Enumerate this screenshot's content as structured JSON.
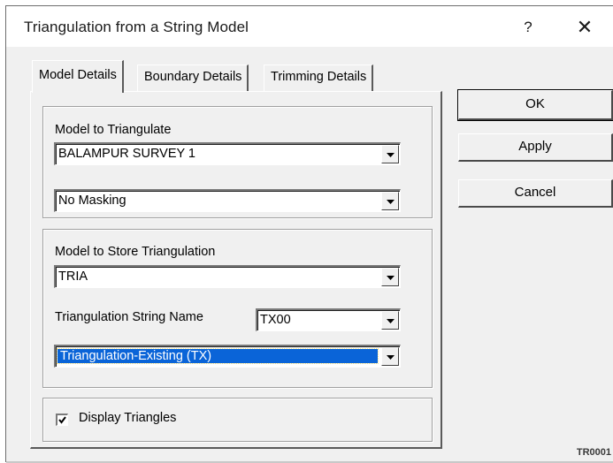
{
  "window": {
    "title": "Triangulation from a String Model",
    "help_label": "?",
    "close_label": "✕"
  },
  "tabs": [
    {
      "label": "Model Details",
      "active": true
    },
    {
      "label": "Boundary Details",
      "active": false
    },
    {
      "label": "Trimming Details",
      "active": false
    }
  ],
  "model_group": {
    "label": "Model to Triangulate",
    "model_value": "BALAMPUR SURVEY 1",
    "masking_value": "No Masking"
  },
  "store_group": {
    "label": "Model to Store Triangulation",
    "store_value": "TRIA",
    "string_name_label": "Triangulation String Name",
    "string_name_value": "TX00",
    "type_value": "Triangulation-Existing (TX)"
  },
  "display": {
    "label": "Display Triangles",
    "checked": true
  },
  "buttons": {
    "ok": "OK",
    "apply": "Apply",
    "cancel": "Cancel"
  },
  "footer": {
    "code": "TR0001"
  },
  "icons": {
    "dropdown": "chevron-down-icon",
    "check": "check-icon"
  },
  "colors": {
    "selection": "#0a64d8",
    "face": "#f0f0f0"
  }
}
